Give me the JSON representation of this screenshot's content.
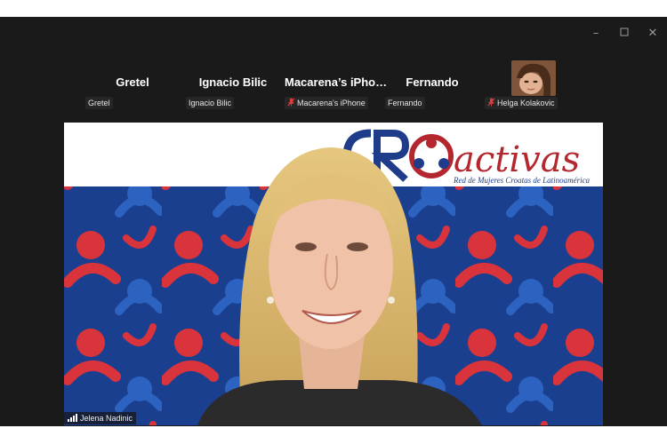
{
  "window": {
    "controls": {
      "minimize_icon": "minimize-icon",
      "maximize_icon": "maximize-icon",
      "close_icon": "close-icon"
    }
  },
  "participants": [
    {
      "display": "Gretel",
      "label": "Gretel",
      "muted": false
    },
    {
      "display": "Ignacio Bilic",
      "label": "Ignacio Bilic",
      "muted": false
    },
    {
      "display": "Macarena’s  iPho…",
      "label": "Macarena's iPhone",
      "muted": true
    },
    {
      "display": "Fernando",
      "label": "Fernando",
      "muted": false
    },
    {
      "display": "",
      "label": "Helga Kolakovic",
      "muted": true,
      "has_photo": true
    }
  ],
  "speaker": {
    "name": "Jelena Nadinic",
    "signal_icon": "signal-bars-icon"
  },
  "banner": {
    "logo_text": "activas",
    "tagline": "Red de Mujeres Croatas de Latinoamérica"
  },
  "colors": {
    "window_bg": "#1a1a1a",
    "pattern_blue": "#1b3f8f",
    "pattern_red": "#d9333b",
    "brand_red": "#b5272f",
    "brand_blue": "#1e3c8a"
  }
}
